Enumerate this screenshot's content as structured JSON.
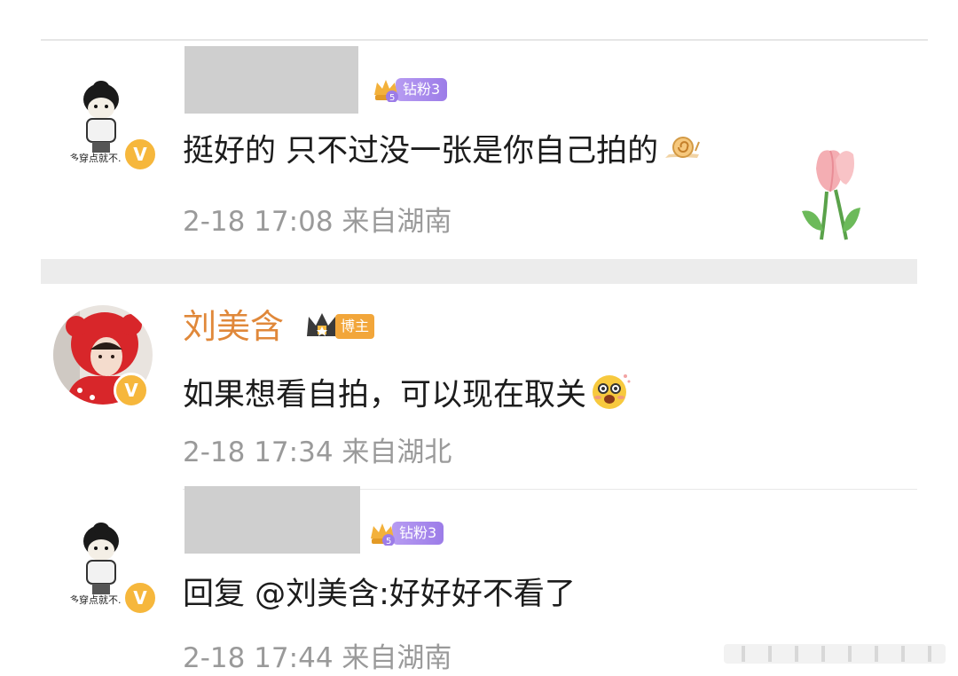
{
  "comments": [
    {
      "username": "",
      "fan_badge": "钻粉3",
      "text": "挺好的 只不过没一张是你自己拍的",
      "time": "2-18 17:08",
      "location": "来自湖南",
      "avatar_caption": "多穿点就不."
    },
    {
      "username": "刘美含",
      "owner_badge": "博主",
      "text": "如果想看自拍，可以现在取关",
      "time": "2-18 17:34",
      "location": "来自湖北"
    },
    {
      "username": "",
      "fan_badge": "钻粉3",
      "text": "回复 @刘美含:好好好不看了",
      "time": "2-18 17:44",
      "location": "来自湖南",
      "avatar_caption": "多穿点就不."
    }
  ],
  "verified_mark": "V",
  "icons": [
    "crown-icon",
    "snail-emoji-icon",
    "tulip-sticker-icon",
    "blushing-face-emoji-icon",
    "verified-badge-icon"
  ],
  "colors": {
    "username": "#e0883a",
    "meta": "#9a9a9a",
    "fan_badge": "#9c7ce8",
    "verified": "#f6b73c"
  }
}
